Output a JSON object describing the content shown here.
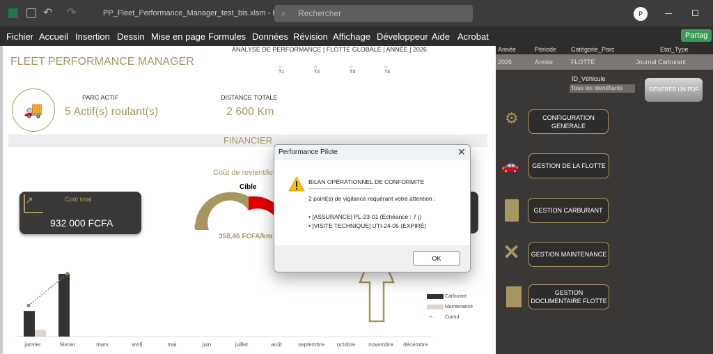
{
  "window": {
    "filename": "PP_Fleet_Performance_Manager_test_bis.xlsm  -  E...",
    "search_placeholder": "Rechercher",
    "avatar": "P",
    "share": "Partag"
  },
  "menu": [
    "Fichier",
    "Accueil",
    "Insertion",
    "Dessin",
    "Mise en page",
    "Formules",
    "Données",
    "Révision",
    "Affichage",
    "Développeur",
    "Aide",
    "Acrobat"
  ],
  "dashboard": {
    "title": "FLEET PERFORMANCE MANAGER",
    "subtitle": "ANALYSE DE PERFORMANCE  |  FLOTTE GLOBALE  |  ANNÉE  |  2026",
    "quarters": [
      "T1",
      "T2",
      "T3",
      "T4"
    ],
    "parc_label": "PARC ACTIF",
    "parc_value": "5 Actif(s) roulant(s)",
    "distance_label": "DISTANCE TOTALE",
    "distance_value": "2 600 Km",
    "section": "FINANCIER",
    "cost_label": "Coût total",
    "cost_value": "932 000 FCFA",
    "gauge_title": "Coût de revient/km",
    "gauge_target": "Cible",
    "gauge_min": "0",
    "gauge_value": "358,46 FCFA/km",
    "gauge_fraction": 0.5,
    "colors": {
      "gold": "#a89660",
      "red": "#e00000",
      "dark": "#3a3836"
    }
  },
  "filters": {
    "headers": [
      "Année",
      "Période",
      "Catégorie_Parc",
      "Etat_Type"
    ],
    "values": [
      "2026",
      "Année",
      "FLOTTE",
      "Journal Carburant"
    ],
    "vehicle_label": "ID_Véhicule",
    "vehicle_value": "Tous les identifiants",
    "pdf_button": "GENERER UN PDF"
  },
  "nav": [
    "CONFIGURATION\nGENERALE",
    "GESTION DE LA FLOTTE",
    "GESTION CARBURANT",
    "GESTION MAINTENANCE",
    "GESTION\nDOCUMENTAIRE FLOTTE"
  ],
  "dialog": {
    "title": "Performance Pilote",
    "heading": "BILAN OPÉRATIONNEL DE CONFORMITE",
    "separator": "-------------------------------------------------------",
    "message": "2 point(s) de vigilance requérant votre attention :",
    "items": [
      "• [ASSURANCE] PL-23-01 (Échéance : 7 j)",
      "• [VISITE TECHNIQUE] UTI-24-05 (EXPIRÉ)"
    ],
    "ok": "OK"
  },
  "chart_data": {
    "type": "bar",
    "categories": [
      "janvier",
      "février",
      "mars",
      "avril",
      "mai",
      "juin",
      "juillet",
      "août",
      "septembre",
      "octobre",
      "novembre",
      "décembre"
    ],
    "series": [
      {
        "name": "Carburant",
        "type": "bar",
        "values": [
          380000,
          930000,
          0,
          0,
          0,
          0,
          0,
          0,
          0,
          0,
          0,
          0
        ]
      },
      {
        "name": "Maintenance",
        "type": "bar",
        "values": [
          100000,
          0,
          0,
          0,
          0,
          0,
          0,
          0,
          0,
          0,
          0,
          0
        ]
      },
      {
        "name": "Cumul",
        "type": "line",
        "values": [
          460000,
          932000,
          null,
          null,
          null,
          null,
          null,
          null,
          null,
          null,
          null,
          null
        ]
      }
    ],
    "ylim": [
      0,
      950000
    ],
    "legend": "right"
  }
}
